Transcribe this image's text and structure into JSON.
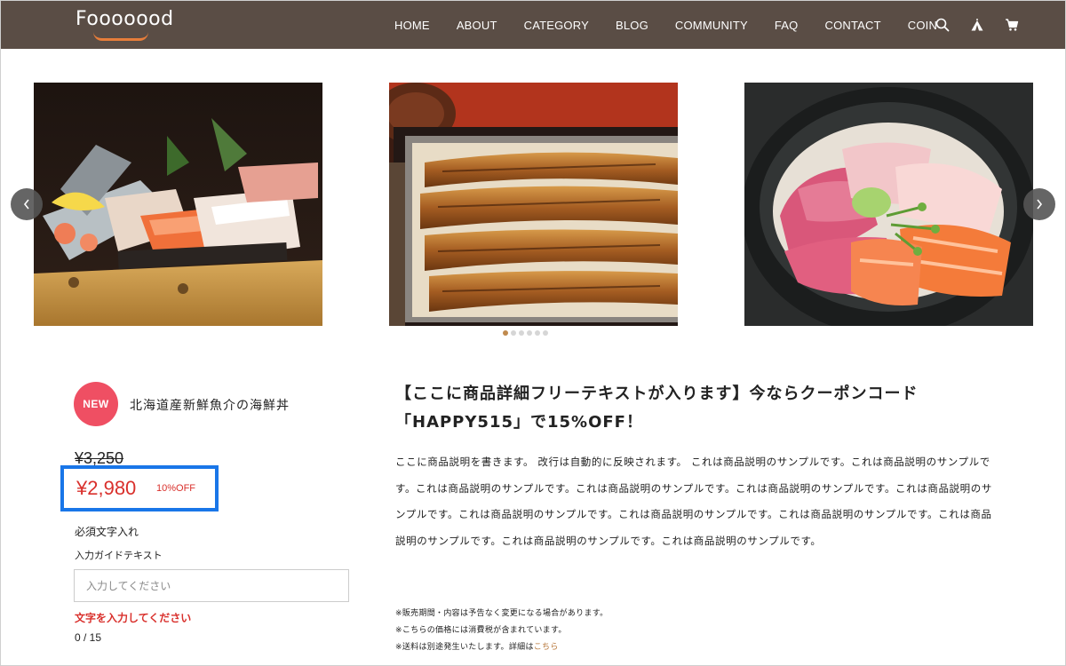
{
  "header": {
    "logo": "Fooooood",
    "nav": [
      "HOME",
      "ABOUT",
      "CATEGORY",
      "BLOG",
      "COMMUNITY",
      "FAQ",
      "CONTACT",
      "COIN"
    ],
    "icons": [
      "search-icon",
      "tent-icon",
      "cart-icon"
    ],
    "background": "#5a4d45"
  },
  "slider": {
    "images": [
      "sashimi-boat-image",
      "unagi-don-image",
      "kaisendon-image"
    ],
    "dot_count": 6,
    "active_dot": 1
  },
  "product": {
    "badge": "NEW",
    "name": "北海道産新鮮魚介の海鮮丼",
    "old_price": "¥3,250",
    "price": "¥2,980",
    "discount": "10%OFF",
    "required_label": "必須文字入れ",
    "guide_label": "入力ガイドテキスト",
    "input_placeholder": "入力してください",
    "input_value": "",
    "error": "文字を入力してください",
    "counter": "0 / 15",
    "accent_color": "#d9302c",
    "highlight_color": "#1976e8"
  },
  "detail": {
    "headline": "【ここに商品詳細フリーテキストが入ります】今ならクーポンコード「HAPPY515」で15%OFF！",
    "description": "ここに商品説明を書きます。 改行は自動的に反映されます。 これは商品説明のサンプルです。これは商品説明のサンプルです。これは商品説明のサンプルです。これは商品説明のサンプルです。これは商品説明のサンプルです。これは商品説明のサンプルです。これは商品説明のサンプルです。これは商品説明のサンプルです。これは商品説明のサンプルです。これは商品説明のサンプルです。これは商品説明のサンプルです。これは商品説明のサンプルです。",
    "notes": [
      "※販売期間・内容は予告なく変更になる場合があります。",
      "※こちらの価格には消費税が含まれています。",
      "※送料は別途発生いたします。詳細は"
    ],
    "link_text": "こちら"
  }
}
